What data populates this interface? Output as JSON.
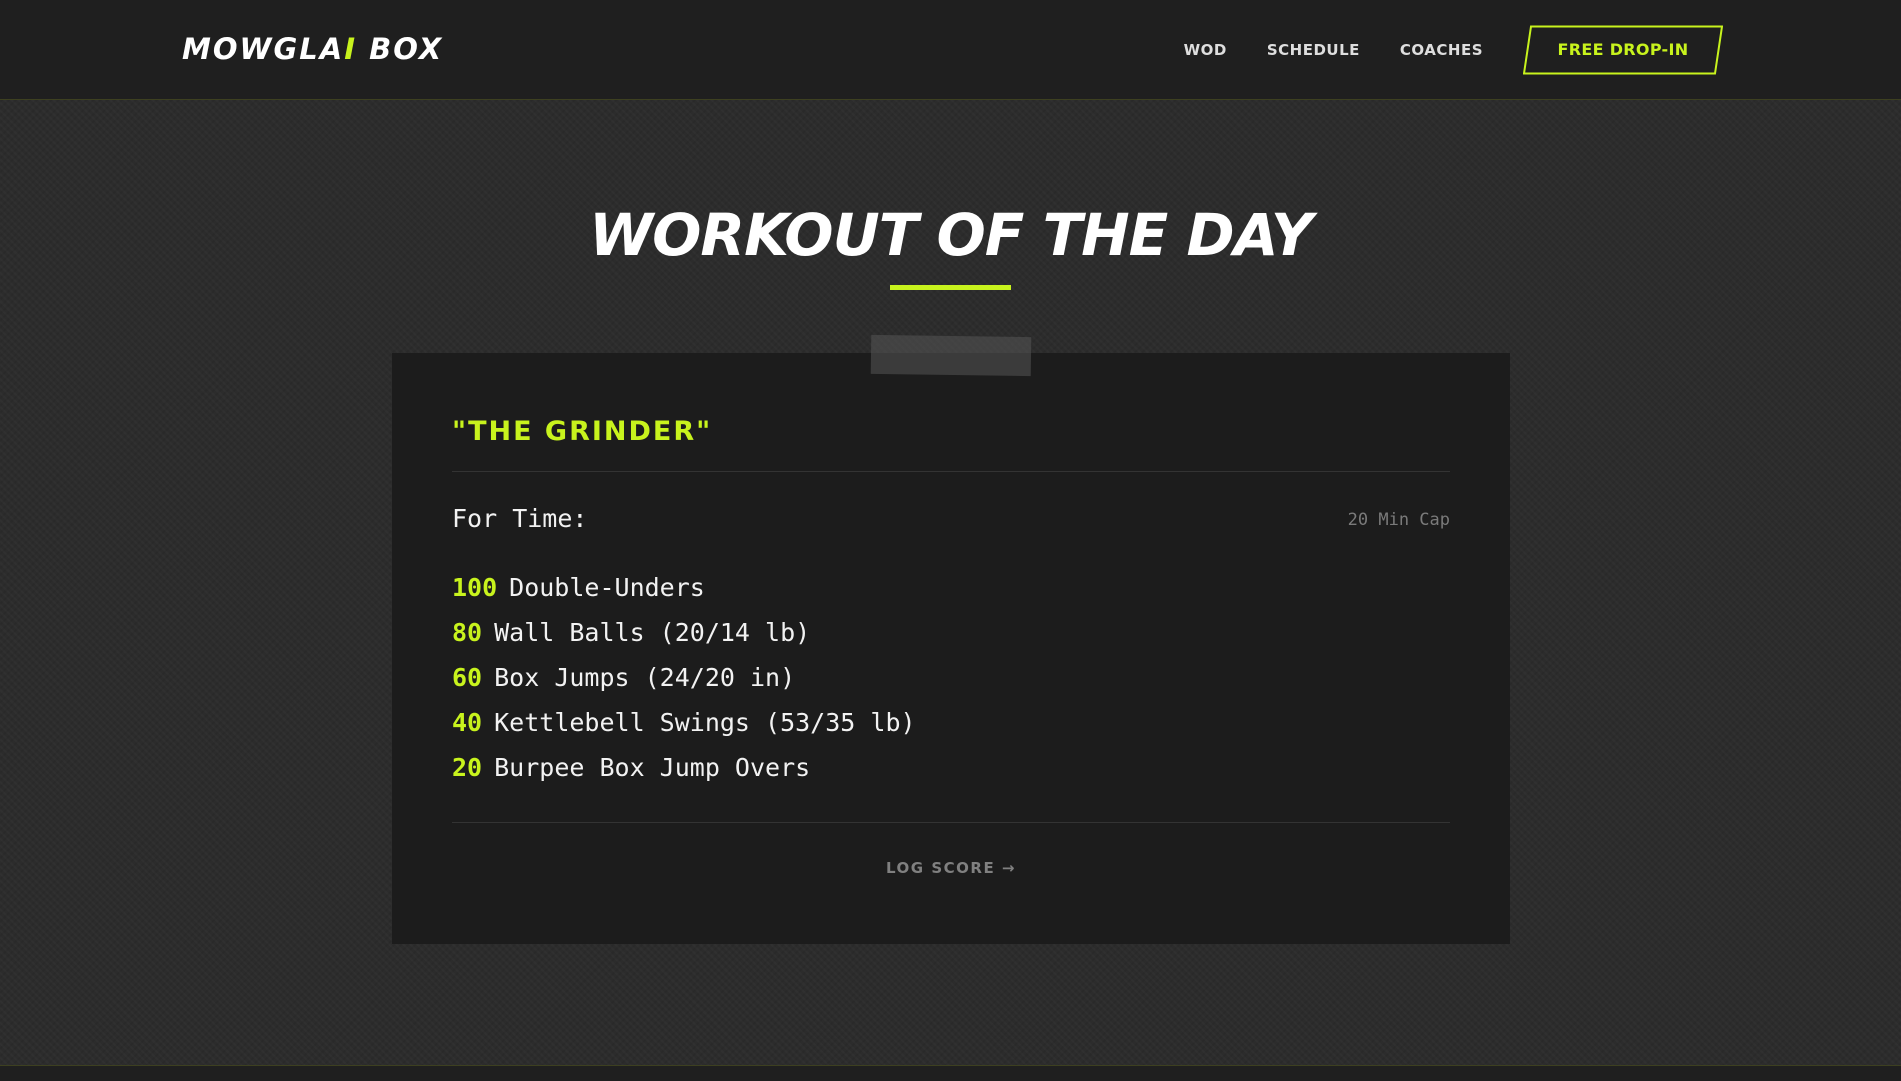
{
  "header": {
    "logo_part1": "MOWGLA",
    "logo_accent": "I",
    "logo_part2": " BOX",
    "nav": {
      "wod": "WOD",
      "schedule": "SCHEDULE",
      "coaches": "COACHES"
    },
    "cta": "FREE DROP-IN"
  },
  "hero": {
    "title": "WORKOUT OF THE DAY"
  },
  "wod": {
    "name": "\"THE GRINDER\"",
    "format": "For Time:",
    "time_cap": "20 Min Cap",
    "movements": [
      {
        "reps": "100",
        "name": "Double-Unders"
      },
      {
        "reps": "80",
        "name": "Wall Balls (20/14 lb)"
      },
      {
        "reps": "60",
        "name": "Box Jumps (24/20 in)"
      },
      {
        "reps": "40",
        "name": "Kettlebell Swings (53/35 lb)"
      },
      {
        "reps": "20",
        "name": "Burpee Box Jump Overs"
      }
    ],
    "log_score": "LOG SCORE →"
  },
  "colors": {
    "accent": "#c8f31d",
    "background": "#2c2c2c",
    "header_bg": "#1f1f1f",
    "card_bg": "#1c1c1c"
  }
}
